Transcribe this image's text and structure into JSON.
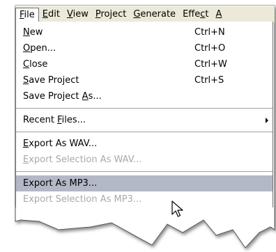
{
  "menubar": {
    "items": [
      {
        "label": "File",
        "underline": "F",
        "active": true
      },
      {
        "label": "Edit",
        "underline": "E"
      },
      {
        "label": "View",
        "underline": "V"
      },
      {
        "label": "Project",
        "underline": "P"
      },
      {
        "label": "Generate",
        "underline": "G"
      },
      {
        "label": "Effect",
        "underline": "c"
      },
      {
        "label": "A",
        "underline": "A"
      }
    ]
  },
  "file_menu": {
    "new": {
      "label": "New",
      "shortcut": "Ctrl+N"
    },
    "open": {
      "label": "Open...",
      "shortcut": "Ctrl+O"
    },
    "close": {
      "label": "Close",
      "shortcut": "Ctrl+W"
    },
    "save_project": {
      "label": "Save Project",
      "shortcut": "Ctrl+S"
    },
    "save_project_as": {
      "label": "Save Project As..."
    },
    "recent_files": {
      "label": "Recent Files..."
    },
    "export_wav": {
      "label": "Export As WAV..."
    },
    "export_sel_wav": {
      "label": "Export Selection As WAV..."
    },
    "export_mp3": {
      "label": "Export As MP3..."
    },
    "export_sel_mp3": {
      "label": "Export Selection As MP3..."
    }
  },
  "colors": {
    "menubar_bg": "#ece9d8",
    "highlight": "#b3b8c6",
    "disabled_text": "#a9a9a9"
  }
}
